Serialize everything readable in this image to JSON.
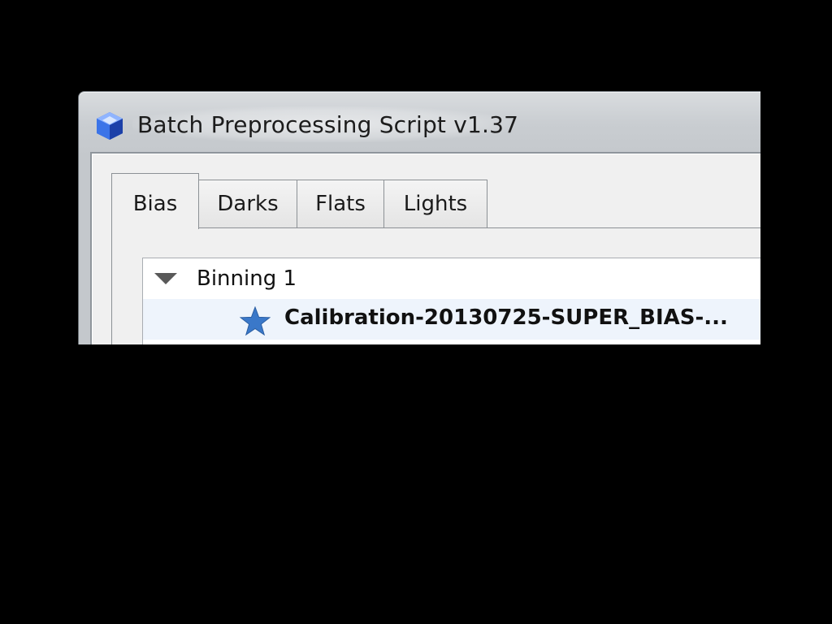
{
  "window": {
    "title": "Batch Preprocessing Script v1.37",
    "app_icon": "pixinsight-cube-icon"
  },
  "tabs": [
    {
      "label": "Bias",
      "active": true
    },
    {
      "label": "Darks",
      "active": false
    },
    {
      "label": "Flats",
      "active": false
    },
    {
      "label": "Lights",
      "active": false
    }
  ],
  "tree": {
    "group": {
      "label": "Binning 1",
      "expander_icon": "triangle-down-icon",
      "expanded": true
    },
    "items": [
      {
        "label": "Calibration-20130725-SUPER_BIAS-...",
        "icon": "star-icon",
        "selected": true
      }
    ]
  },
  "colors": {
    "screen_background": "#000000",
    "star_icon": "#3a78c9",
    "selected_row": "#eef4fc"
  }
}
